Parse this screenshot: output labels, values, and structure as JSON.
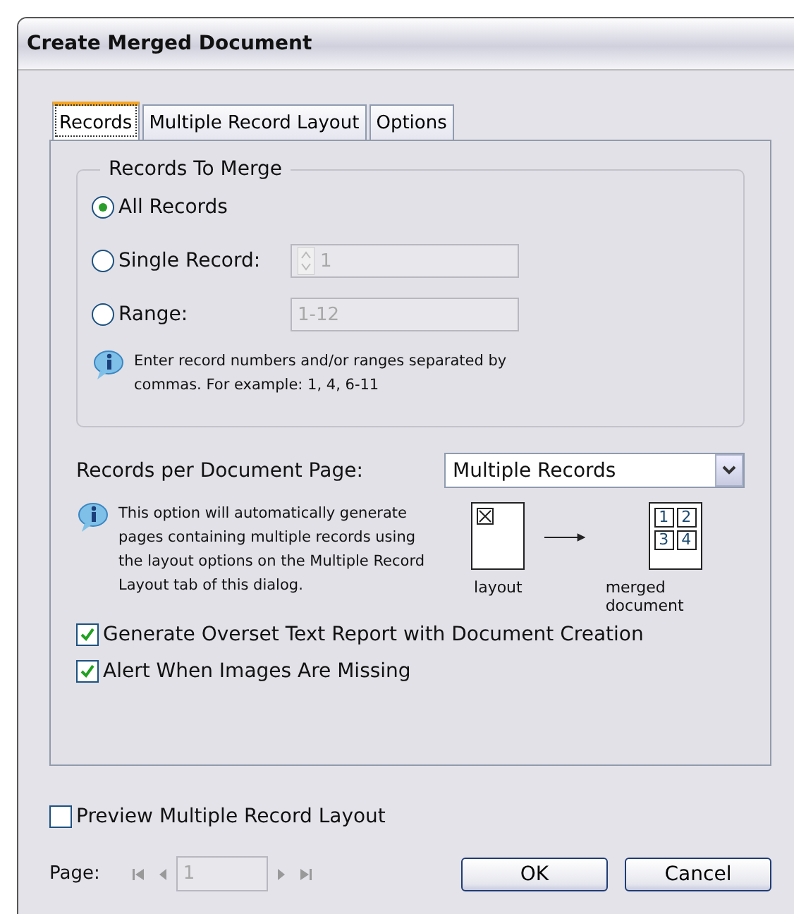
{
  "window": {
    "title": "Create Merged Document"
  },
  "tabs": [
    {
      "label": "Records",
      "selected": true
    },
    {
      "label": "Multiple Record Layout",
      "selected": false
    },
    {
      "label": "Options",
      "selected": false
    }
  ],
  "records_to_merge": {
    "title": "Records To Merge",
    "options": [
      {
        "kind": "plain",
        "label": "All Records",
        "selected": true
      },
      {
        "kind": "spinner",
        "label": "Single Record:",
        "selected": false,
        "value": "1",
        "disabled": true
      },
      {
        "kind": "field",
        "label": "Range:",
        "selected": false,
        "value": "1-12",
        "disabled": true
      }
    ],
    "info": "Enter record numbers and/or ranges separated by commas. For example: 1, 4, 6-11"
  },
  "records_per_page": {
    "label": "Records per Document Page:",
    "value": "Multiple Records"
  },
  "layout_info": "This option will automatically generate pages containing multiple records using the layout options on the Multiple Record Layout tab of this dialog.",
  "diagram": {
    "layout_label": "layout",
    "merged_cells": [
      "1",
      "2",
      "3",
      "4"
    ],
    "merged_label": "merged document"
  },
  "checkboxes": [
    {
      "label": "Generate Overset Text Report with Document Creation",
      "checked": true
    },
    {
      "label": "Alert When Images Are Missing",
      "checked": true
    }
  ],
  "preview": {
    "label": "Preview Multiple Record Layout",
    "checked": false
  },
  "pager": {
    "label": "Page:",
    "value": "1",
    "disabled": true
  },
  "buttons": [
    "OK",
    "Cancel"
  ]
}
